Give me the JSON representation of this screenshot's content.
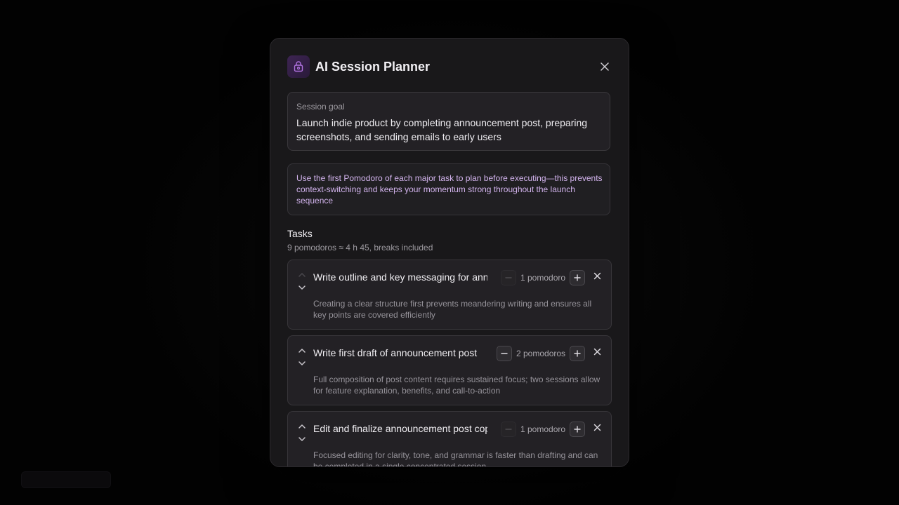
{
  "background": {
    "title": "",
    "badge": ""
  },
  "modal": {
    "title": "AI Session Planner",
    "icon": "lock-bag-icon",
    "accent": "#b072e0"
  },
  "goal": {
    "label": "Session goal",
    "text": "Launch indie product by completing announcement post, preparing screenshots, and sending emails to early users"
  },
  "tip": {
    "text": "Use the first Pomodoro of each major task to plan before executing—this prevents context-switching and keeps your momentum strong throughout the launch sequence"
  },
  "tasks_section": {
    "heading": "Tasks",
    "summary": "9 pomodoros ≈ 4 h 45, breaks included"
  },
  "tasks": [
    {
      "title": "Write outline and key messaging for announcement post",
      "count": "1 pomodoro",
      "description": "Creating a clear structure first prevents meandering writing and ensures all key points are covered efficiently"
    },
    {
      "title": "Write first draft of announcement post",
      "count": "2 pomodoros",
      "description": "Full composition of post content requires sustained focus; two sessions allow for feature explanation, benefits, and call-to-action"
    },
    {
      "title": "Edit and finalize announcement post copy",
      "count": "1 pomodoro",
      "description": "Focused editing for clarity, tone, and grammar is faster than drafting and can be completed in a single concentrated session"
    }
  ]
}
